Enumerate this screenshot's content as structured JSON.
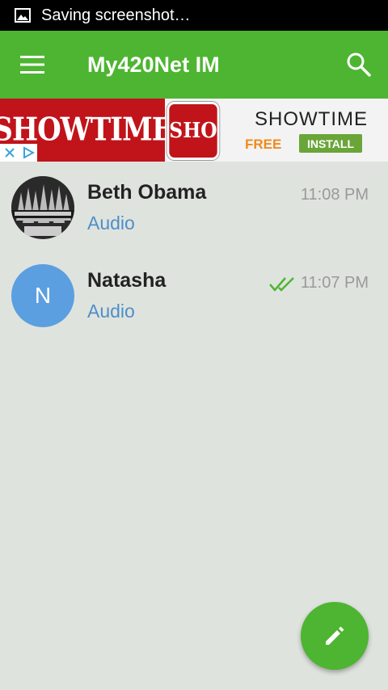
{
  "status_bar": {
    "text": "Saving screenshot…",
    "icon": "image-icon"
  },
  "app_bar": {
    "title": "My420Net IM",
    "menu_icon": "menu-icon",
    "search_icon": "search-icon",
    "color": "#4db531"
  },
  "ad": {
    "brand_logo": "SHOWTIME",
    "app_icon_text": "SHO",
    "title": "SHOWTIME",
    "price": "FREE",
    "install_label": "INSTALL"
  },
  "chats": [
    {
      "name": "Beth Obama",
      "preview": "Audio",
      "time": "11:08 PM",
      "avatar_type": "image"
    },
    {
      "name": "Natasha",
      "preview": "Audio",
      "time": "11:07 PM",
      "avatar_letter": "N",
      "avatar_type": "letter",
      "read_status": "double-check-icon"
    }
  ],
  "fab": {
    "icon": "pencil-icon"
  }
}
